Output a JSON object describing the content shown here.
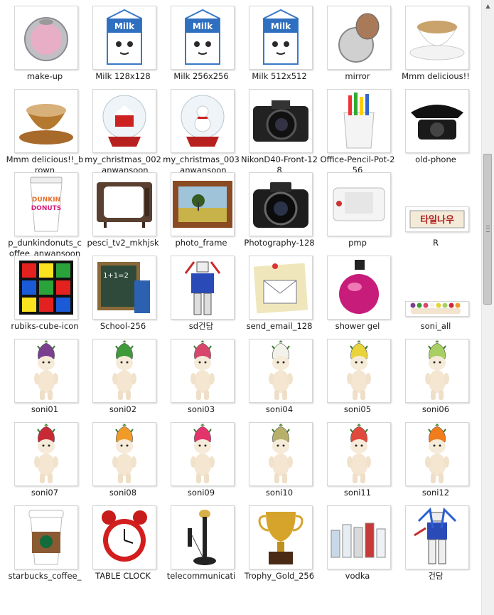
{
  "files": [
    {
      "name": "make-up",
      "icon": "compact-icon"
    },
    {
      "name": "Milk 128x128",
      "icon": "milk-carton-icon"
    },
    {
      "name": "Milk 256x256",
      "icon": "milk-carton-icon"
    },
    {
      "name": "Milk 512x512",
      "icon": "milk-carton-icon"
    },
    {
      "name": "mirror",
      "icon": "mirror-icon"
    },
    {
      "name": "Mmm delicious!!",
      "icon": "coffee-cup-icon"
    },
    {
      "name": "Mmm delicious!!_brown",
      "icon": "coffee-cup-brown-icon"
    },
    {
      "name": "my_christmas_002_anwansoon",
      "icon": "snow-globe-house-icon"
    },
    {
      "name": "my_christmas_003_anwansoon",
      "icon": "snow-globe-snowman-icon"
    },
    {
      "name": "NikonD40-Front-128",
      "icon": "camera-icon"
    },
    {
      "name": "Office-Pencil-Pot-256",
      "icon": "pencil-pot-icon"
    },
    {
      "name": "old-phone",
      "icon": "old-phone-icon"
    },
    {
      "name": "p_dunkindonuts_coffee_anwansoon",
      "icon": "dunkin-cup-icon"
    },
    {
      "name": "pesci_tv2_mkhjsk",
      "icon": "retro-tv-icon"
    },
    {
      "name": "photo_frame",
      "icon": "photo-frame-icon"
    },
    {
      "name": "Photography-128",
      "icon": "dslr-icon"
    },
    {
      "name": "pmp",
      "icon": "media-player-icon"
    },
    {
      "name": "R",
      "icon": "sign-icon"
    },
    {
      "name": "rubiks-cube-icon",
      "icon": "rubiks-cube-icon"
    },
    {
      "name": "School-256",
      "icon": "chalkboard-icon"
    },
    {
      "name": "sd건담",
      "icon": "robot-icon"
    },
    {
      "name": "send_email_128",
      "icon": "envelope-note-icon"
    },
    {
      "name": "shower gel",
      "icon": "shower-gel-icon"
    },
    {
      "name": "soni_all",
      "icon": "doll-row-icon"
    },
    {
      "name": "soni01",
      "icon": "doll-icon",
      "color": "#7a3f8f"
    },
    {
      "name": "soni02",
      "icon": "doll-icon",
      "color": "#3f9a3a"
    },
    {
      "name": "soni03",
      "icon": "doll-icon",
      "color": "#d9466b"
    },
    {
      "name": "soni04",
      "icon": "doll-icon",
      "color": "#f2f2ea"
    },
    {
      "name": "soni05",
      "icon": "doll-icon",
      "color": "#e8d43a"
    },
    {
      "name": "soni06",
      "icon": "doll-icon",
      "color": "#a8cf63"
    },
    {
      "name": "soni07",
      "icon": "doll-icon",
      "color": "#c82a35"
    },
    {
      "name": "soni08",
      "icon": "doll-icon",
      "color": "#f09a28"
    },
    {
      "name": "soni09",
      "icon": "doll-icon",
      "color": "#e2336b"
    },
    {
      "name": "soni10",
      "icon": "doll-icon",
      "color": "#b6b06a"
    },
    {
      "name": "soni11",
      "icon": "doll-icon",
      "color": "#e04a3c"
    },
    {
      "name": "soni12",
      "icon": "doll-icon",
      "color": "#f07c1c"
    },
    {
      "name": "starbucks_coffee_",
      "icon": "starbucks-cup-icon"
    },
    {
      "name": "TABLE CLOCK",
      "icon": "alarm-clock-icon"
    },
    {
      "name": "telecommunicati",
      "icon": "candlestick-phone-icon"
    },
    {
      "name": "Trophy_Gold_256",
      "icon": "trophy-icon"
    },
    {
      "name": "vodka",
      "icon": "bottles-icon"
    },
    {
      "name": "건담",
      "icon": "gundam-icon"
    }
  ]
}
